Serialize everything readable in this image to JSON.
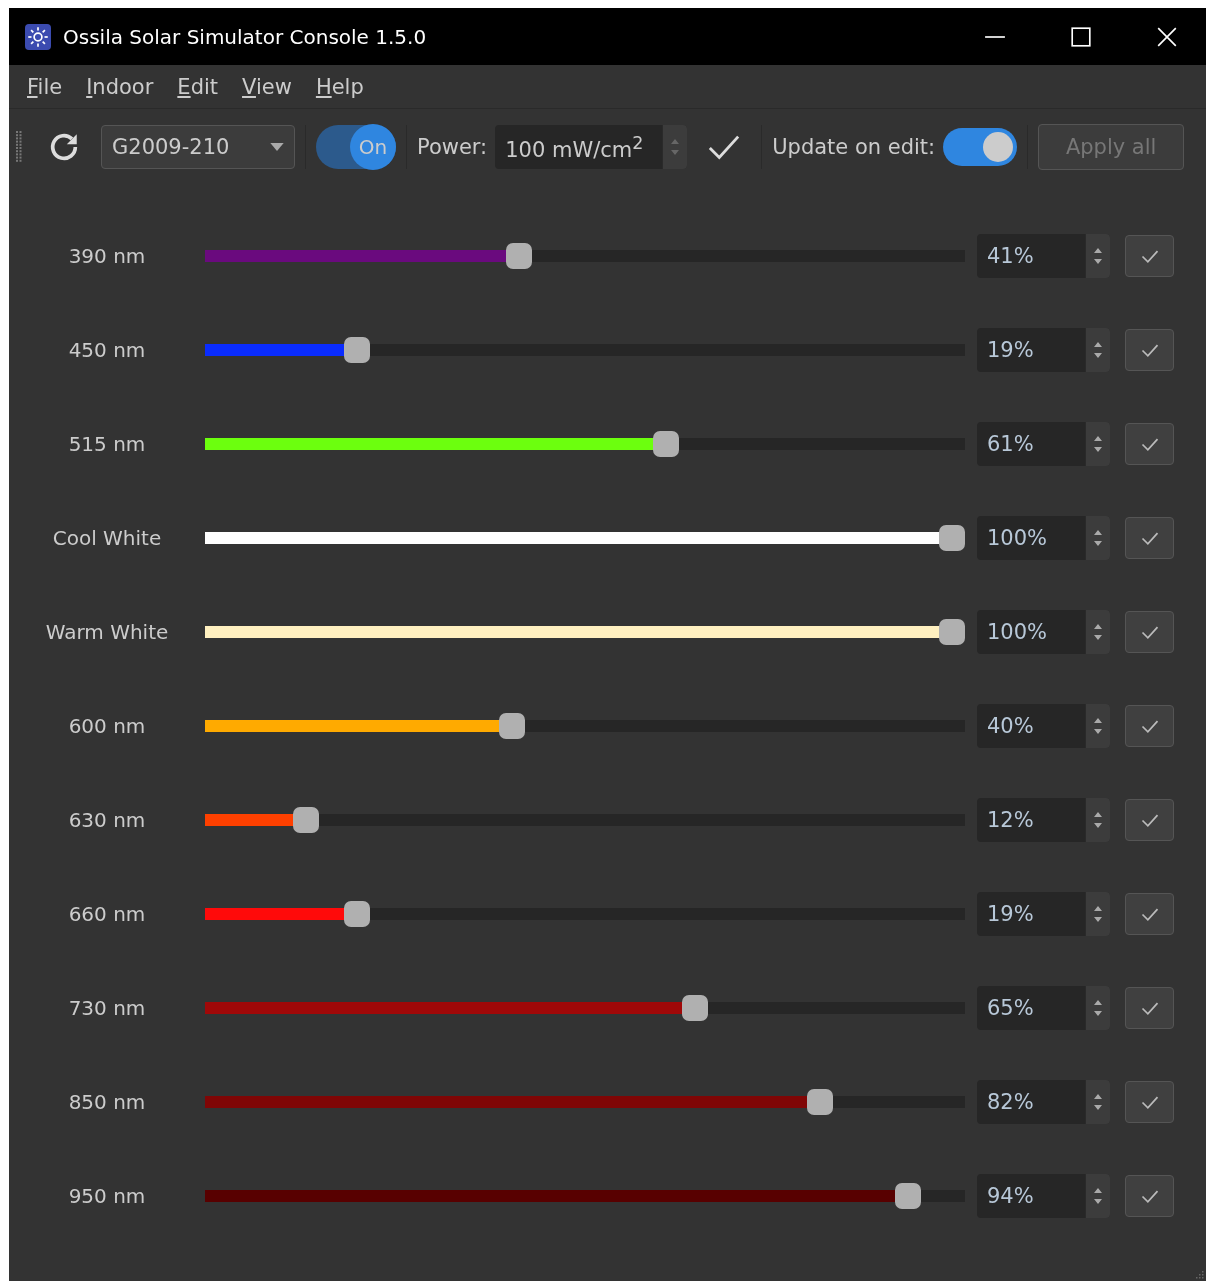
{
  "window": {
    "title": "Ossila Solar Simulator Console 1.5.0"
  },
  "menu": [
    {
      "key": "F",
      "rest": "ile"
    },
    {
      "key": "I",
      "rest": "ndoor"
    },
    {
      "key": "E",
      "rest": "dit"
    },
    {
      "key": "V",
      "rest": "iew"
    },
    {
      "key": "H",
      "rest": "elp"
    }
  ],
  "toolbar": {
    "device": "G2009-210",
    "power_switch": {
      "label": "On",
      "on": true
    },
    "power_label": "Power:",
    "power_value": "100 mW/cm$^{2}$",
    "update_label": "Update on edit:",
    "update_switch": {
      "on": true
    },
    "apply_all": {
      "label": "Apply all",
      "disabled": true
    }
  },
  "channels": [
    {
      "name": "390 nm",
      "color": "#6a0a7e",
      "level": 0.41,
      "reading": "41%"
    },
    {
      "name": "450 nm",
      "color": "#0a2cff",
      "level": 0.19,
      "reading": "19%"
    },
    {
      "name": "515 nm",
      "color": "#6cff0e",
      "level": 0.61,
      "reading": "61%"
    },
    {
      "name": "Cool White",
      "color": "#ffffff",
      "level": 1.0,
      "reading": "100%"
    },
    {
      "name": "Warm White",
      "color": "#fff0c0",
      "level": 1.0,
      "reading": "100%"
    },
    {
      "name": "600 nm",
      "color": "#ffaa00",
      "level": 0.4,
      "reading": "40%"
    },
    {
      "name": "630 nm",
      "color": "#ff4000",
      "level": 0.12,
      "reading": "12%"
    },
    {
      "name": "660 nm",
      "color": "#ff0a0a",
      "level": 0.19,
      "reading": "19%"
    },
    {
      "name": "730 nm",
      "color": "#a00808",
      "level": 0.65,
      "reading": "65%"
    },
    {
      "name": "850 nm",
      "color": "#800606",
      "level": 0.82,
      "reading": "82%"
    },
    {
      "name": "950 nm",
      "color": "#580000",
      "level": 0.94,
      "reading": "94%"
    }
  ]
}
